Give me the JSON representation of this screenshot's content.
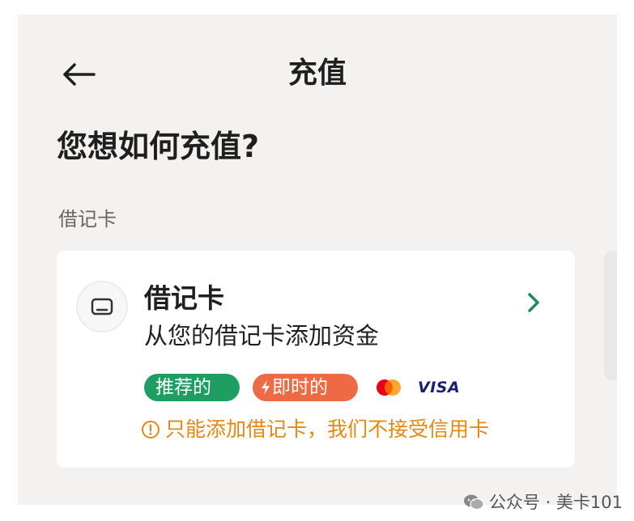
{
  "header": {
    "title": "充值",
    "back_icon": "arrow-left-icon"
  },
  "question": "您想如何充值?",
  "section": {
    "label": "借记卡"
  },
  "card": {
    "icon": "card-icon",
    "title": "借记卡",
    "subtitle": "从您的借记卡添加资金",
    "badges": {
      "recommended": "推荐的",
      "instant": "即时的"
    },
    "badge_colors": {
      "recommended": "#1e9e63",
      "instant": "#ee6a45"
    },
    "payment_brands": {
      "mastercard": "mastercard-logo",
      "visa": "VISA"
    },
    "warning": "只能添加借记卡，我们不接受信用卡",
    "warning_color": "#e8870f",
    "chevron": "chevron-right-icon",
    "chevron_color": "#1e8a5a"
  },
  "watermark": {
    "text": "公众号 · 美卡101"
  }
}
